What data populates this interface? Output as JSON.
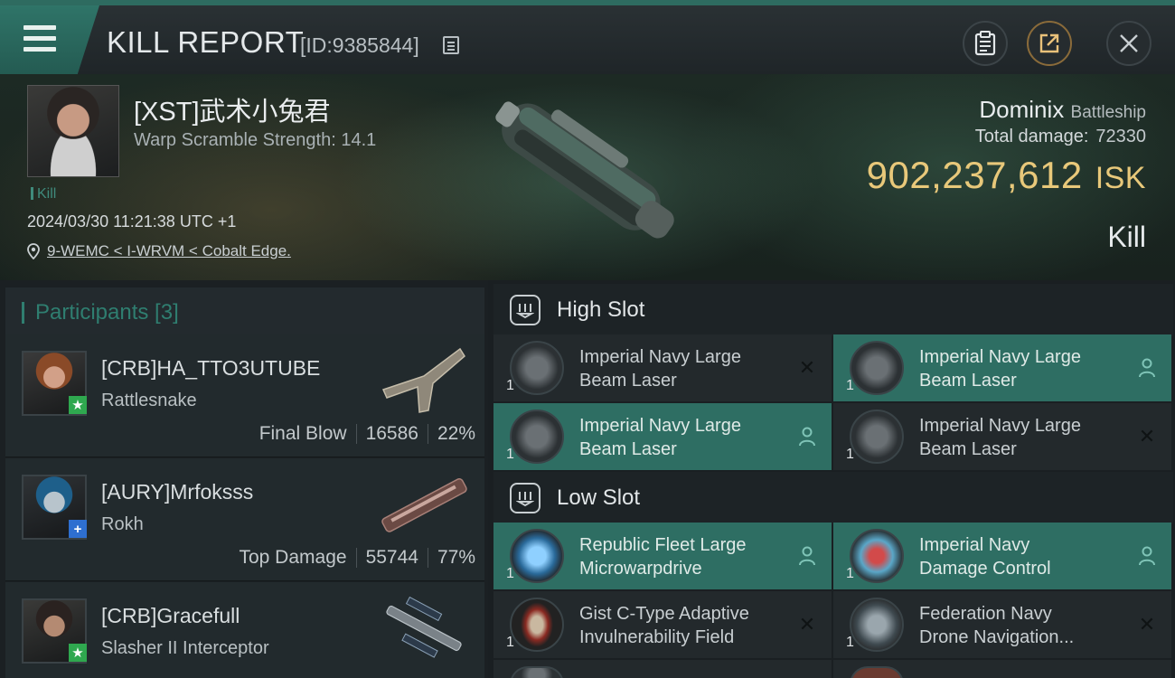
{
  "header": {
    "title": "KILL REPORT",
    "report_id": "[ID:9385844]"
  },
  "victim": {
    "name": "[XST]武术小兔君",
    "warp_strength": "Warp Scramble Strength: 14.1",
    "tag": "Kill",
    "datetime": "2024/03/30 11:21:38 UTC +1",
    "location": "9-WEMC < I-WRVM < Cobalt Edge."
  },
  "ship": {
    "name": "Dominix",
    "class": "Battleship",
    "total_damage_label": "Total damage:",
    "total_damage_value": "72330",
    "isk_value": "902,237,612",
    "isk_unit": "ISK",
    "result": "Kill"
  },
  "participants": {
    "title": "Participants [3]",
    "items": [
      {
        "name": "[CRB]HA_TTO3UTUBE",
        "ship": "Rattlesnake",
        "role": "Final Blow",
        "damage": "16586",
        "percent": "22%",
        "badge": "★",
        "badge_color": "#2fa84f"
      },
      {
        "name": "[AURY]Mrfoksss",
        "ship": "Rokh",
        "role": "Top Damage",
        "damage": "55744",
        "percent": "77%",
        "badge": "+",
        "badge_color": "#2e6fd0"
      },
      {
        "name": "[CRB]Gracefull",
        "ship": "Slasher II Interceptor",
        "role": "",
        "damage": "",
        "percent": "",
        "badge": "★",
        "badge_color": "#2fa84f"
      }
    ]
  },
  "fittings": {
    "high_slot_title": "High Slot",
    "low_slot_title": "Low Slot",
    "high": [
      {
        "line1": "Imperial Navy Large",
        "line2": "Beam Laser",
        "qty": "1",
        "status": "destroyed"
      },
      {
        "line1": "Imperial Navy Large",
        "line2": "Beam Laser",
        "qty": "1",
        "status": "dropped"
      },
      {
        "line1": "Imperial Navy Large",
        "line2": "Beam Laser",
        "qty": "1",
        "status": "dropped"
      },
      {
        "line1": "Imperial Navy Large",
        "line2": "Beam Laser",
        "qty": "1",
        "status": "destroyed"
      }
    ],
    "low": [
      {
        "line1": "Republic Fleet Large",
        "line2": "Microwarpdrive",
        "qty": "1",
        "status": "dropped"
      },
      {
        "line1": "Imperial Navy",
        "line2": "Damage Control",
        "qty": "1",
        "status": "dropped"
      },
      {
        "line1": "Gist C-Type Adaptive",
        "line2": "Invulnerability Field",
        "qty": "1",
        "status": "destroyed"
      },
      {
        "line1": "Federation Navy",
        "line2": "Drone Navigation...",
        "qty": "1",
        "status": "destroyed"
      }
    ]
  },
  "colors": {
    "accent": "#2e6e63",
    "isk": "#e8c87a",
    "teal_text": "#2f7e70"
  }
}
